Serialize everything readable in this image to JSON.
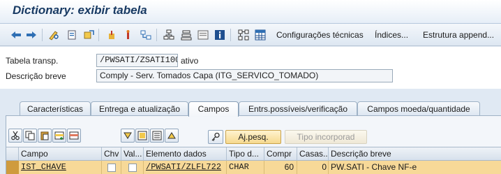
{
  "window": {
    "title": "Dictionary: exibir tabela",
    "accent_color": "#183a63"
  },
  "toolbar": {
    "icons": [
      "back-arrow-icon",
      "forward-arrow-icon",
      "display-change-icon",
      "other-object-icon",
      "activate-icon",
      "check-icon",
      "where-used-icon",
      "hierarchy-icon",
      "object-list-icon",
      "display-object-list-icon",
      "info-icon",
      "graphic-icon",
      "table-grid-icon"
    ],
    "technical_settings": "Configurações técnicas",
    "indexes": "Índices...",
    "append_structure": "Estrutura append..."
  },
  "header": {
    "table_label": "Tabela transp.",
    "table_value": "/PWSATI/ZSATI100",
    "table_status": "ativo",
    "description_label": "Descrição breve",
    "description_value": "Comply - Serv. Tomados Capa (ITG_SERVICO_TOMADO)"
  },
  "tabs": [
    {
      "label": "Características",
      "active": false
    },
    {
      "label": "Entrega e atualização",
      "active": false
    },
    {
      "label": "Campos",
      "active": true
    },
    {
      "label": "Entrs.possíveis/verificação",
      "active": false
    },
    {
      "label": "Campos moeda/quantidade",
      "active": false
    }
  ],
  "grid_toolbar": {
    "icons": [
      "cut-icon",
      "copy-icon",
      "paste-icon",
      "insert-row-icon",
      "delete-row-icon",
      "sort-down-icon",
      "select-block-icon",
      "select-all-icon",
      "sort-up-icon",
      "key-icon"
    ],
    "search_help_button": "Aj.pesq.",
    "built_in_type_button": "Tipo incorporad"
  },
  "grid": {
    "headers": [
      "Campo",
      "Chv",
      "Val...",
      "Elemento dados",
      "Tipo d...",
      "Compr",
      "Casas...",
      "Descrição breve"
    ],
    "rows": [
      {
        "campo": "IST_CHAVE",
        "chv": false,
        "val": false,
        "elemento": "/PWSATI/ZLFL722",
        "tipo": "CHAR",
        "compr": "60",
        "casas": "0",
        "descricao": "PW.SATI - Chave NF-e"
      }
    ],
    "selected_row_color": "#f7d998"
  }
}
